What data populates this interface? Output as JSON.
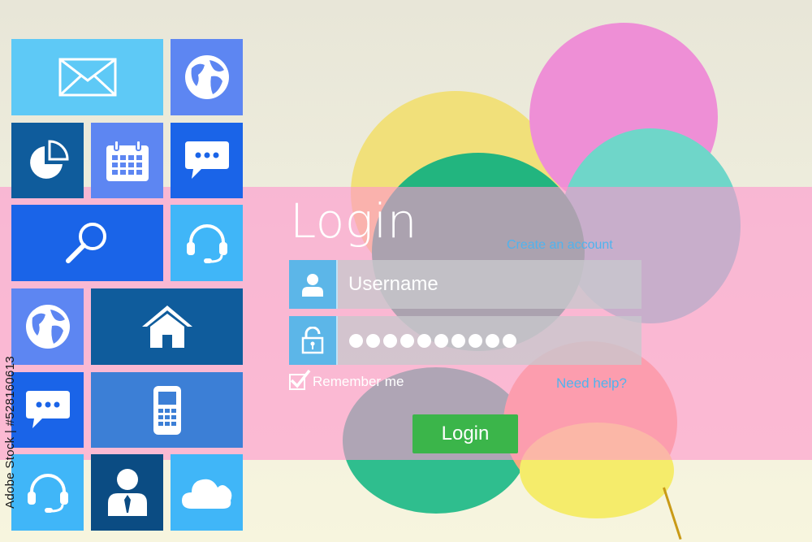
{
  "colors": {
    "tile_light": "#5ec9f6",
    "tile_sky": "#40b6f8",
    "tile_blue": "#1a64e8",
    "tile_navy": "#0f5c9c",
    "tile_peri": "#5d86f2",
    "band_pink": "#ff96cd",
    "field_icon": "#5cb6e8",
    "link": "#4fb3ee",
    "login_button": "#3bb54a"
  },
  "tiles": [
    {
      "icon": "mail-icon"
    },
    {
      "icon": "globe-icon"
    },
    {
      "icon": "pie-chart-icon"
    },
    {
      "icon": "calendar-icon"
    },
    {
      "icon": "chat-icon"
    },
    {
      "icon": "search-icon"
    },
    {
      "icon": "headset-icon"
    },
    {
      "icon": "globe-icon"
    },
    {
      "icon": "home-icon"
    },
    {
      "icon": "chat-icon"
    },
    {
      "icon": "mobile-phone-icon"
    },
    {
      "icon": "headset-icon"
    },
    {
      "icon": "user-icon"
    },
    {
      "icon": "cloud-icon"
    }
  ],
  "login": {
    "title": "Login",
    "create_account": "Create an account",
    "username_placeholder": "Username",
    "password_mask_count": 10,
    "remember_label": "Remember me",
    "remember_checked": true,
    "need_help": "Need help?",
    "button_label": "Login"
  },
  "watermark": {
    "stock_id": "Adobe Stock | #528160613"
  }
}
